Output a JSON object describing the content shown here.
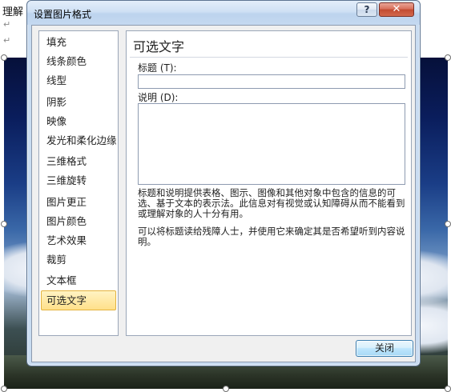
{
  "document": {
    "visible_text": "理解",
    "paragraph_mark": "↵"
  },
  "dialog": {
    "title": "设置图片格式",
    "help_label": "?",
    "close_glyph": "✕",
    "nav_items": [
      {
        "label": "填充"
      },
      {
        "label": "线条颜色"
      },
      {
        "label": "线型"
      },
      {
        "label": "阴影"
      },
      {
        "label": "映像"
      },
      {
        "label": "发光和柔化边缘"
      },
      {
        "label": "三维格式"
      },
      {
        "label": "三维旋转"
      },
      {
        "label": "图片更正"
      },
      {
        "label": "图片颜色"
      },
      {
        "label": "艺术效果"
      },
      {
        "label": "裁剪"
      },
      {
        "label": "文本框"
      },
      {
        "label": "可选文字"
      }
    ],
    "selected_item": "可选文字",
    "panel": {
      "heading": "可选文字",
      "title_label": "标题 (T):",
      "title_value": "",
      "desc_label": "说明 (D):",
      "desc_value": "",
      "help_text_1": "标题和说明提供表格、图示、图像和其他对象中包含的信息的可选、基于文本的表示法。此信息对有视觉或认知障碍从而不能看到或理解对象的人十分有用。",
      "help_text_2": "可以将标题读给残障人士，并使用它来确定其是否希望听到内容说明。"
    },
    "close_button_label": "关闭"
  },
  "colors": {
    "dialog_frame": "#c9dcf1",
    "selected_item_bg": "#ffe08a",
    "close_button": "#c24a31"
  }
}
